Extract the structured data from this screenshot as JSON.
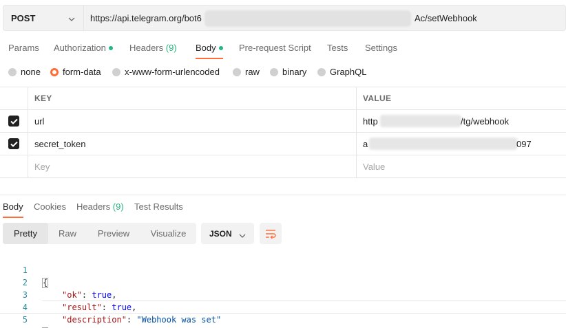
{
  "request": {
    "method": "POST",
    "url_prefix": "https://api.telegram.org/bot6",
    "url_suffix": "Ac/setWebhook"
  },
  "request_tabs": [
    {
      "label": "Params"
    },
    {
      "label": "Authorization"
    },
    {
      "label": "Headers",
      "count": "(9)"
    },
    {
      "label": "Body"
    },
    {
      "label": "Pre-request Script"
    },
    {
      "label": "Tests"
    },
    {
      "label": "Settings"
    }
  ],
  "body_types": [
    "none",
    "form-data",
    "x-www-form-urlencoded",
    "raw",
    "binary",
    "GraphQL"
  ],
  "body_type_selected": "form-data",
  "table": {
    "key_header": "KEY",
    "value_header": "VALUE",
    "rows": [
      {
        "checked": true,
        "key": "url",
        "value_start": "http",
        "value_end": "/tg/webhook"
      },
      {
        "checked": true,
        "key": "secret_token",
        "value_start": "a",
        "value_end": "097"
      }
    ],
    "key_placeholder": "Key",
    "value_placeholder": "Value"
  },
  "response_tabs": [
    {
      "label": "Body"
    },
    {
      "label": "Cookies"
    },
    {
      "label": "Headers",
      "count": "(9)"
    },
    {
      "label": "Test Results"
    }
  ],
  "view_modes": [
    "Pretty",
    "Raw",
    "Preview",
    "Visualize"
  ],
  "format": "JSON",
  "response_json": {
    "line_numbers": [
      "1",
      "2",
      "3",
      "4",
      "5"
    ],
    "open_brace": "{",
    "close_brace": "}",
    "ok_key": "\"ok\"",
    "ok_value": "true",
    "result_key": "\"result\"",
    "result_value": "true",
    "description_key": "\"description\"",
    "description_value": "\"Webhook was set\""
  },
  "colors": {
    "accent": "#ff6c37",
    "indicator": "#26b47f"
  },
  "icons": {
    "method_dropdown": "chevron-down-icon",
    "format_dropdown": "chevron-down-icon",
    "wrap": "wrap-lines-icon",
    "checkbox": "check-icon"
  }
}
